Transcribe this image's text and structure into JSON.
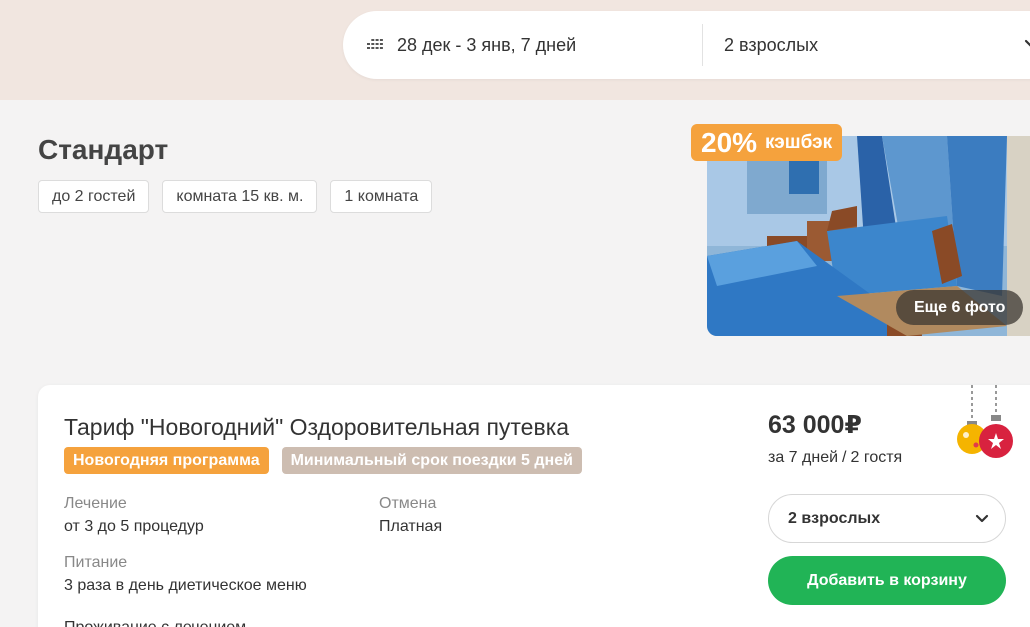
{
  "search": {
    "dates": "28 дек - 3 янв, 7 дней",
    "guests": "2 взрослых"
  },
  "room": {
    "title": "Стандарт",
    "chips": [
      "до 2 гостей",
      "комната 15 кв. м.",
      "1 комната"
    ]
  },
  "photo": {
    "cashback_percent": "20%",
    "cashback_word": "кэшбэк",
    "more_photos": "Еще 6 фото"
  },
  "tariff": {
    "title": "Тариф \"Новогодний\" Оздоровительная путевка",
    "badges": [
      "Новогодняя программа",
      "Минимальный срок поездки 5 дней"
    ],
    "treatment_label": "Лечение",
    "treatment_value": "от 3 до 5 процедур",
    "cancel_label": "Отмена",
    "cancel_value": "Платная",
    "food_label": "Питание",
    "food_value": "3 раза в день диетическое меню",
    "cut_text": "Проживание с лечением"
  },
  "price": {
    "amount": "63 000₽",
    "period": "за 7 дней",
    "sep": "/",
    "guests": "2 гостя"
  },
  "booking": {
    "guest_select": "2 взрослых",
    "add_button": "Добавить в корзину"
  },
  "colors": {
    "accent_green": "#21b456",
    "accent_orange": "#f5a23d",
    "badge_gray": "#cdbdb1",
    "top_band": "#f1e6e0"
  }
}
